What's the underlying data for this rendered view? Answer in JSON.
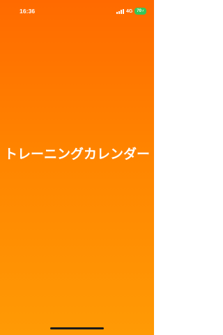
{
  "status_bar": {
    "time": "16:36",
    "network": "4G",
    "battery": "70"
  },
  "splash": {
    "title": "トレーニングカレンダー"
  },
  "colors": {
    "background_top": "#ff6a00",
    "background_bottom": "#ff9a05",
    "battery_badge": "#34c759"
  },
  "icons": [
    "signal-icon",
    "charging-bolt-icon"
  ]
}
